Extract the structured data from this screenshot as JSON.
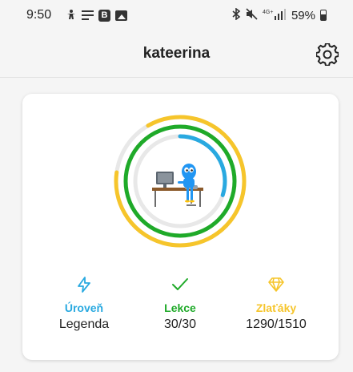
{
  "status_bar": {
    "time": "9:50",
    "left_icons": [
      "accessibility-icon",
      "notes-icon",
      "b-app-icon",
      "image-icon"
    ],
    "right_icons": [
      "bluetooth-icon",
      "mute-icon",
      "lte-signal-icon",
      "battery-icon"
    ],
    "network": "4G+",
    "battery": "59%"
  },
  "header": {
    "title": "kateerina",
    "settings_icon": "gear-icon"
  },
  "progress": {
    "outer_ring_fraction": 0.855,
    "middle_ring_fraction": 1.0,
    "inner_ring_fraction": 0.3,
    "illustration": "mascot-at-computer-desk"
  },
  "stats": [
    {
      "icon": "lightning-icon",
      "label": "Úroveň",
      "value": "Legenda",
      "color": "#29a9e0"
    },
    {
      "icon": "check-icon",
      "label": "Lekce",
      "value": "30/30",
      "color": "#1faa29"
    },
    {
      "icon": "diamond-icon",
      "label": "Zlaťáky",
      "value": "1290/1510",
      "color": "#f6c52b"
    }
  ],
  "colors": {
    "outer_ring": "#f6c52b",
    "middle_ring": "#1faa29",
    "inner_ring": "#29a9e0",
    "track": "#e8e8e8"
  }
}
